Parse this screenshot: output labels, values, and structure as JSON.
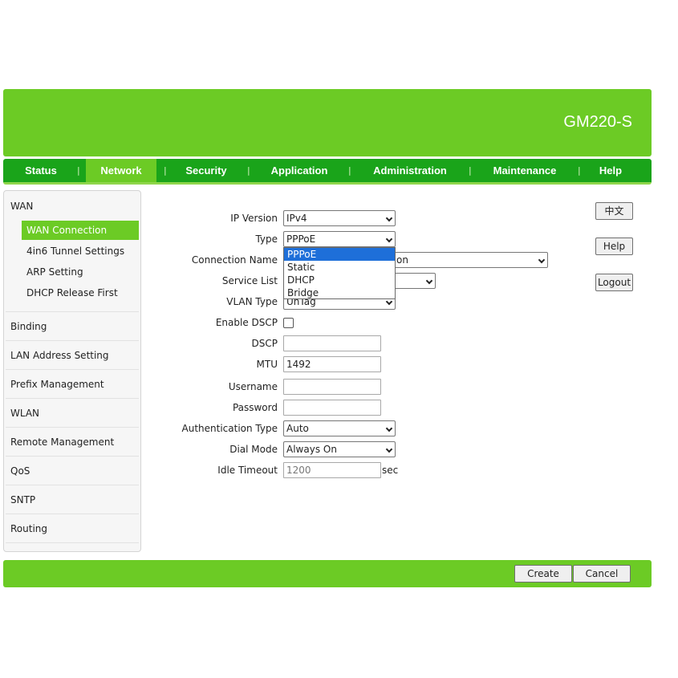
{
  "header": {
    "model": "GM220-S"
  },
  "nav": {
    "tabs": [
      {
        "label": "Status"
      },
      {
        "label": "Network"
      },
      {
        "label": "Security"
      },
      {
        "label": "Application"
      },
      {
        "label": "Administration"
      },
      {
        "label": "Maintenance"
      },
      {
        "label": "Help"
      }
    ],
    "separator": "|",
    "active": "Network"
  },
  "sidebar": {
    "wan": "WAN",
    "wan_items": [
      "WAN Connection",
      "4in6 Tunnel Settings",
      "ARP Setting",
      "DHCP Release First"
    ],
    "groups": [
      "Binding",
      "LAN Address Setting",
      "Prefix Management",
      "WLAN",
      "Remote Management",
      "QoS",
      "SNTP",
      "Routing"
    ]
  },
  "form": {
    "ip_version": {
      "label": "IP Version",
      "value": "IPv4"
    },
    "type": {
      "label": "Type",
      "value": "PPPoE",
      "options": [
        "PPPoE",
        "Static",
        "DHCP",
        "Bridge"
      ]
    },
    "connection_name": {
      "label": "Connection Name",
      "value_suffix": "on"
    },
    "service_list": {
      "label": "Service List"
    },
    "vlan_type": {
      "label": "VLAN Type",
      "value": "UnTag"
    },
    "enable_dscp": {
      "label": "Enable DSCP",
      "checked": false
    },
    "dscp": {
      "label": "DSCP",
      "value": ""
    },
    "mtu": {
      "label": "MTU",
      "value": "1492"
    },
    "username": {
      "label": "Username",
      "value": ""
    },
    "password": {
      "label": "Password",
      "value": ""
    },
    "auth_type": {
      "label": "Authentication Type",
      "value": "Auto"
    },
    "dial_mode": {
      "label": "Dial Mode",
      "value": "Always On"
    },
    "idle_timeout": {
      "label": "Idle Timeout",
      "value": "1200",
      "unit": "sec"
    }
  },
  "side_buttons": {
    "language": "中文",
    "help": "Help",
    "logout": "Logout"
  },
  "footer": {
    "create": "Create",
    "cancel": "Cancel"
  },
  "colors": {
    "banner": "#6ccb25",
    "nav": "#1aa41a",
    "highlight": "#1e6fd9"
  }
}
